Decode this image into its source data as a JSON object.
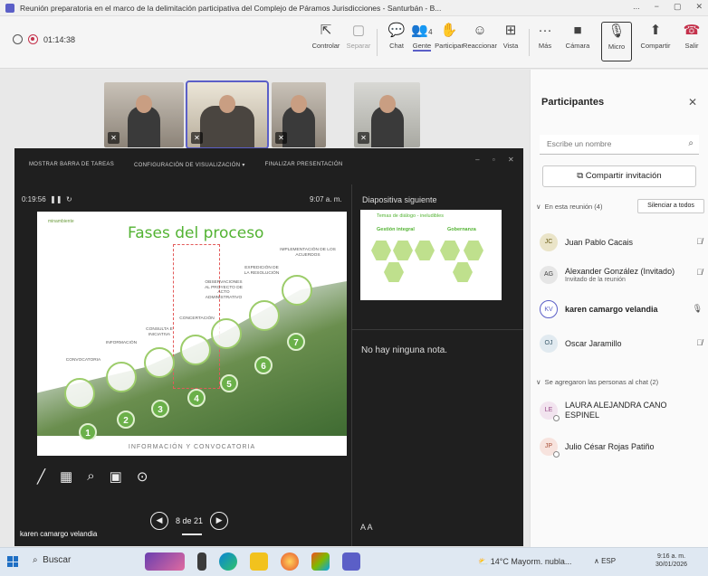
{
  "window": {
    "title": "Reunión preparatoria en el marco de la delimitación participativa del Complejo de Páramos Jurisdicciones - Santurbán - B...",
    "controls": [
      "...",
      "−",
      "▢",
      "✕"
    ]
  },
  "toolbar": {
    "timer": "01:14:38",
    "buttons": [
      {
        "label": "Controlar",
        "icon": "⇱"
      },
      {
        "label": "Separar",
        "icon": "▢"
      },
      {
        "label": "Chat",
        "icon": "💬"
      },
      {
        "label": "Gente",
        "icon": "👥",
        "badge": "4"
      },
      {
        "label": "Participar",
        "icon": "✋"
      },
      {
        "label": "Reaccionar",
        "icon": "☺"
      },
      {
        "label": "Vista",
        "icon": "⊞"
      },
      {
        "label": "Más",
        "icon": "···"
      },
      {
        "label": "Cámara",
        "icon": "■"
      },
      {
        "label": "Micro",
        "icon": "🎙"
      },
      {
        "label": "Compartir",
        "icon": "⬆"
      },
      {
        "label": "Salir",
        "icon": "☎"
      }
    ]
  },
  "presenter": {
    "topbar": [
      "MOSTRAR BARRA DE TAREAS",
      "CONFIGURACIÓN DE VISUALIZACIÓN ▾",
      "FINALIZAR PRESENTACIÓN"
    ],
    "elapsed": "0:19:56",
    "clock": "9:07 a. m.",
    "next_label": "Diapositiva siguiente",
    "notes": "No hay ninguna nota.",
    "page": "8 de 21",
    "font_ctl": "A  A",
    "slide": {
      "title": "Fases del proceso",
      "logo": "minambiente",
      "steps": [
        {
          "num": "1",
          "label": "CONVOCATORIA"
        },
        {
          "num": "2",
          "label": "INFORMACIÓN"
        },
        {
          "num": "3",
          "label": "CONSULTA E INICIATIVA"
        },
        {
          "num": "4",
          "label": "CONCERTACIÓN"
        },
        {
          "num": "5",
          "label": "OBSERVACIONES AL PROYECTO DE ACTO ADMINISTRATIVO"
        },
        {
          "num": "6",
          "label": "EXPEDICIÓN DE LA RESOLUCIÓN"
        },
        {
          "num": "7",
          "label": "IMPLEMENTACIÓN DE LOS ACUERDOS"
        }
      ],
      "footer": "INFORMACIÓN Y CONVOCATORIA"
    },
    "next_slide": {
      "title": "Temas de diálogo - ineludibles",
      "col1": "Gestión integral",
      "col2": "Gobernanza",
      "nums": [
        "1",
        "2",
        "3",
        "4",
        "5",
        "6"
      ]
    }
  },
  "name_tag": "karen camargo velandia",
  "panel": {
    "title": "Participantes",
    "search_placeholder": "Escribe un nombre",
    "invite": "Compartir invitación",
    "in_meeting": "En esta reunión (4)",
    "mute_all": "Silenciar a todos",
    "participants": [
      {
        "initials": "JC",
        "name": "Juan Pablo Cacais",
        "sub": "",
        "mic": "muted"
      },
      {
        "initials": "AG",
        "name": "Alexander González (Invitado)",
        "sub": "Invitado de la reunión",
        "mic": "muted"
      },
      {
        "initials": "KV",
        "name": "karen camargo velandia",
        "sub": "",
        "mic": "on"
      },
      {
        "initials": "OJ",
        "name": "Oscar Jaramillo",
        "sub": "",
        "mic": "muted"
      }
    ],
    "chat_section": "Se agregaron las personas al chat (2)",
    "chat_people": [
      {
        "initials": "LE",
        "name": "LAURA ALEJANDRA CANO ESPINEL"
      },
      {
        "initials": "JP",
        "name": "Julio César Rojas Patiño"
      }
    ]
  },
  "taskbar": {
    "search": "Buscar",
    "weather": "14°C  Mayorm. nubla...",
    "tray": "∧  ESP",
    "time": "9:16 a. m.",
    "date": "30/01/2026"
  },
  "colors": {
    "accent": "#5b5fc7",
    "leave": "#c4314b",
    "slide_green": "#53b333"
  }
}
